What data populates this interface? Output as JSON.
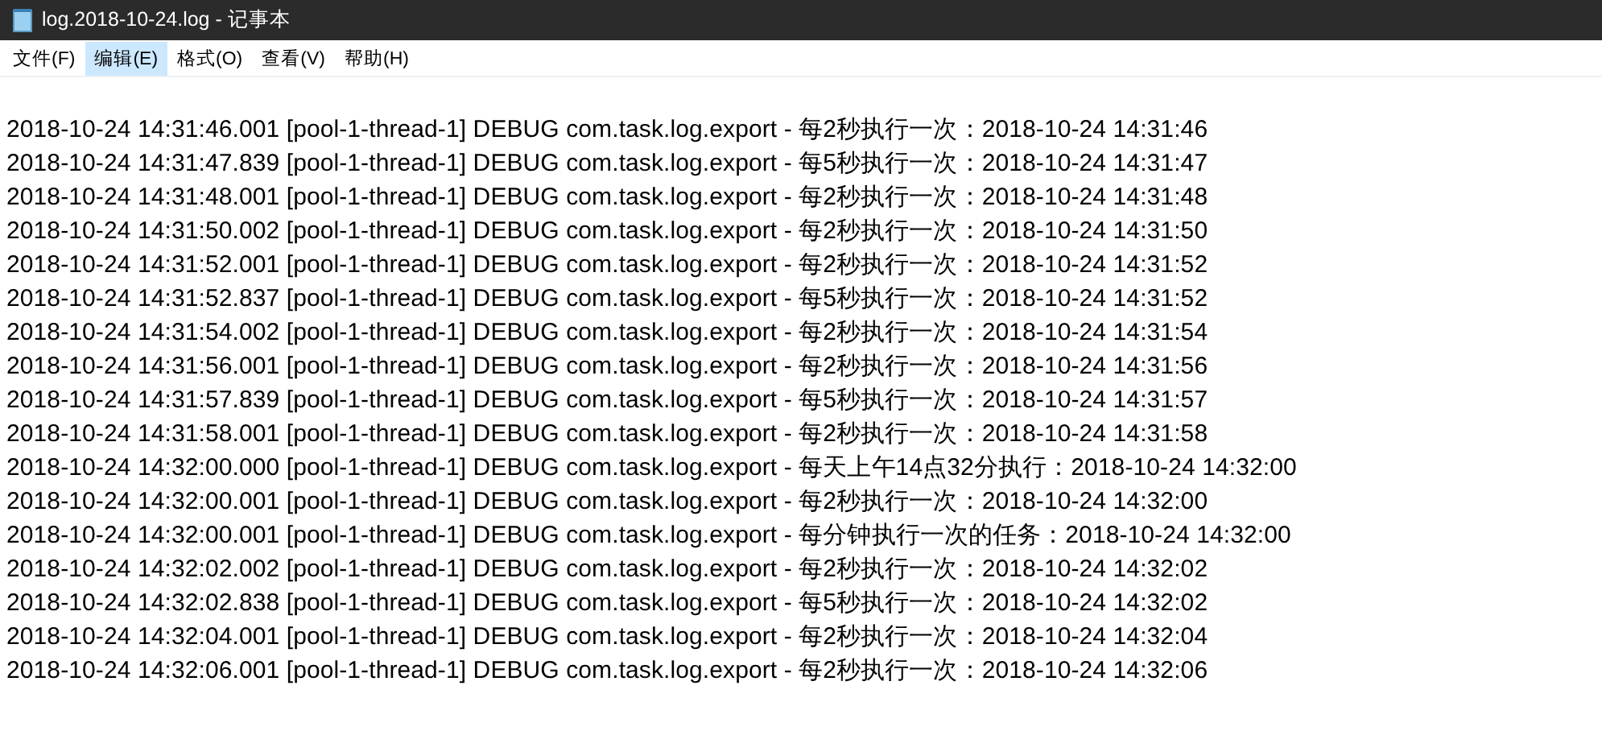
{
  "window": {
    "title": "log.2018-10-24.log - 记事本"
  },
  "menu": [
    {
      "label": "文件(F)",
      "selected": false
    },
    {
      "label": "编辑(E)",
      "selected": true
    },
    {
      "label": "格式(O)",
      "selected": false
    },
    {
      "label": "查看(V)",
      "selected": false
    },
    {
      "label": "帮助(H)",
      "selected": false
    }
  ],
  "lines": [
    "2018-10-24 14:31:46.001 [pool-1-thread-1] DEBUG com.task.log.export - 每2秒执行一次：2018-10-24 14:31:46",
    "2018-10-24 14:31:47.839 [pool-1-thread-1] DEBUG com.task.log.export - 每5秒执行一次：2018-10-24 14:31:47",
    "2018-10-24 14:31:48.001 [pool-1-thread-1] DEBUG com.task.log.export - 每2秒执行一次：2018-10-24 14:31:48",
    "2018-10-24 14:31:50.002 [pool-1-thread-1] DEBUG com.task.log.export - 每2秒执行一次：2018-10-24 14:31:50",
    "2018-10-24 14:31:52.001 [pool-1-thread-1] DEBUG com.task.log.export - 每2秒执行一次：2018-10-24 14:31:52",
    "2018-10-24 14:31:52.837 [pool-1-thread-1] DEBUG com.task.log.export - 每5秒执行一次：2018-10-24 14:31:52",
    "2018-10-24 14:31:54.002 [pool-1-thread-1] DEBUG com.task.log.export - 每2秒执行一次：2018-10-24 14:31:54",
    "2018-10-24 14:31:56.001 [pool-1-thread-1] DEBUG com.task.log.export - 每2秒执行一次：2018-10-24 14:31:56",
    "2018-10-24 14:31:57.839 [pool-1-thread-1] DEBUG com.task.log.export - 每5秒执行一次：2018-10-24 14:31:57",
    "2018-10-24 14:31:58.001 [pool-1-thread-1] DEBUG com.task.log.export - 每2秒执行一次：2018-10-24 14:31:58",
    "2018-10-24 14:32:00.000 [pool-1-thread-1] DEBUG com.task.log.export - 每天上午14点32分执行：2018-10-24 14:32:00",
    "2018-10-24 14:32:00.001 [pool-1-thread-1] DEBUG com.task.log.export - 每2秒执行一次：2018-10-24 14:32:00",
    "2018-10-24 14:32:00.001 [pool-1-thread-1] DEBUG com.task.log.export - 每分钟执行一次的任务：2018-10-24 14:32:00",
    "2018-10-24 14:32:02.002 [pool-1-thread-1] DEBUG com.task.log.export - 每2秒执行一次：2018-10-24 14:32:02",
    "2018-10-24 14:32:02.838 [pool-1-thread-1] DEBUG com.task.log.export - 每5秒执行一次：2018-10-24 14:32:02",
    "2018-10-24 14:32:04.001 [pool-1-thread-1] DEBUG com.task.log.export - 每2秒执行一次：2018-10-24 14:32:04",
    "2018-10-24 14:32:06.001 [pool-1-thread-1] DEBUG com.task.log.export - 每2秒执行一次：2018-10-24 14:32:06"
  ]
}
